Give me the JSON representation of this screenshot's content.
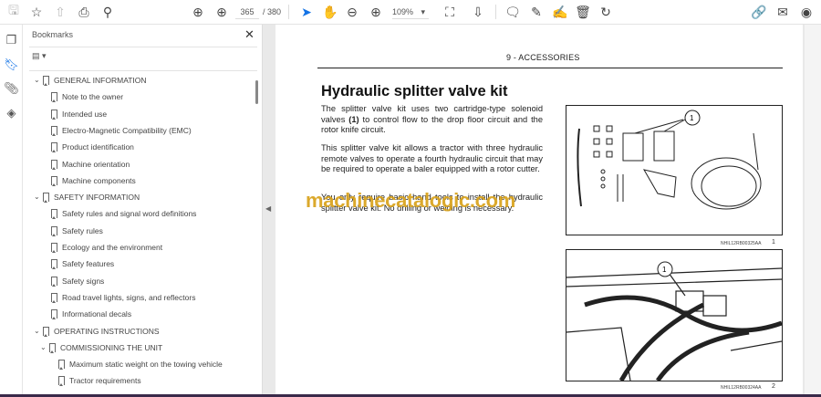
{
  "toolbar": {
    "page_current": "365",
    "page_total": "/ 380",
    "zoom": "109%"
  },
  "sidebar": {
    "title": "Bookmarks",
    "close": "✕",
    "options": "▤ ▾",
    "items": [
      {
        "label": "GENERAL INFORMATION",
        "level": 0,
        "expanded": true
      },
      {
        "label": "Note to the owner",
        "level": 1
      },
      {
        "label": "Intended use",
        "level": 1
      },
      {
        "label": "Electro-Magnetic Compatibility (EMC)",
        "level": 1
      },
      {
        "label": "Product identification",
        "level": 1
      },
      {
        "label": "Machine orientation",
        "level": 1
      },
      {
        "label": "Machine components",
        "level": 1
      },
      {
        "label": "SAFETY INFORMATION",
        "level": 0,
        "expanded": true
      },
      {
        "label": "Safety rules and signal word definitions",
        "level": 1
      },
      {
        "label": "Safety rules",
        "level": 1
      },
      {
        "label": "Ecology and the environment",
        "level": 1
      },
      {
        "label": "Safety features",
        "level": 1
      },
      {
        "label": "Safety signs",
        "level": 1
      },
      {
        "label": "Road travel lights, signs, and reflectors",
        "level": 1
      },
      {
        "label": "Informational decals",
        "level": 1
      },
      {
        "label": "OPERATING INSTRUCTIONS",
        "level": 0,
        "expanded": true
      },
      {
        "label": "COMMISSIONING THE UNIT",
        "level": 1,
        "expanded": true
      },
      {
        "label": "Maximum static weight on the towing vehicle",
        "level": 2
      },
      {
        "label": "Tractor requirements",
        "level": 2
      }
    ]
  },
  "document": {
    "section_header": "9 - ACCESSORIES",
    "title": "Hydraulic splitter valve kit",
    "para1_a": "The splitter valve kit uses two cartridge-type solenoid valves ",
    "para1_b": "(1)",
    "para1_c": " to control flow to the drop floor circuit and the rotor knife circuit.",
    "para2": "This splitter valve kit allows a tractor with three hydraulic remote valves to operate a fourth hydraulic circuit that may be required to operate a baler equipped with a rotor cutter.",
    "para3": "You only require basic hand tools to install the hydraulic splitter valve kit. No drilling or welding is necessary.",
    "figures": [
      {
        "callout": "1",
        "code": "NHIL12RB00325AA",
        "number": "1"
      },
      {
        "callout": "1",
        "code": "NHIL12RB00324AA",
        "number": "2"
      }
    ],
    "watermark": "machinecatalogic.com"
  }
}
